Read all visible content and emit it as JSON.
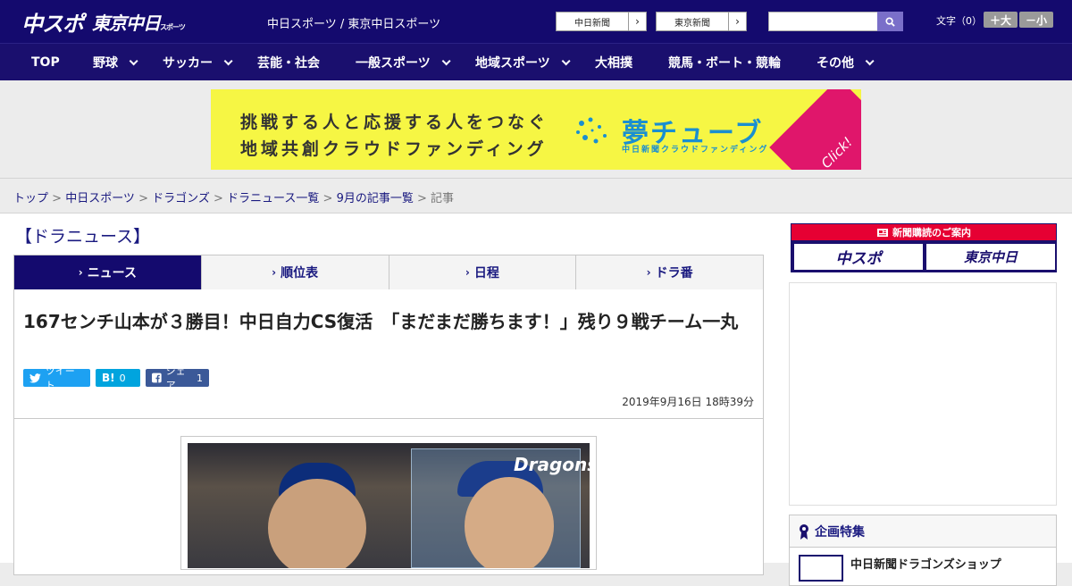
{
  "header": {
    "logo_main": "中スポ",
    "logo_sub": "東京中日",
    "logo_sub_small": "スポーツ",
    "site_title": "中日スポーツ / 東京中日スポーツ",
    "ext_links": [
      {
        "label": "中日新聞"
      },
      {
        "label": "東京新聞"
      }
    ],
    "search_placeholder": "",
    "font_size_label": "文字（0）",
    "font_bigger": "＋大",
    "font_smaller": "－小"
  },
  "nav": {
    "items": [
      {
        "label": "TOP"
      },
      {
        "label": "野球"
      },
      {
        "label": "サッカー"
      },
      {
        "label": "芸能・社会"
      },
      {
        "label": "一般スポーツ"
      },
      {
        "label": "地域スポーツ"
      },
      {
        "label": "大相撲"
      },
      {
        "label": "競馬・ボート・競輪"
      },
      {
        "label": "その他"
      }
    ]
  },
  "banner": {
    "line1": "挑戦する人と応援する人をつなぐ",
    "line2": "地域共創クラウドファンディング",
    "brand": "夢チューブ",
    "brand_sub": "中日新聞クラウドファンディング",
    "click": "Click!"
  },
  "breadcrumb": {
    "items": [
      "トップ",
      "中日スポーツ",
      "ドラゴンズ",
      "ドラニュース一覧",
      "9月の記事一覧"
    ],
    "current": "記事",
    "separator": " > "
  },
  "section_title": "【ドラニュース】",
  "tabs": [
    {
      "label": "ニュース"
    },
    {
      "label": "順位表"
    },
    {
      "label": "日程"
    },
    {
      "label": "ドラ番"
    }
  ],
  "article": {
    "headline": "167センチ山本が３勝目！中日自力CS復活　「まだまだ勝ちます！」残り９戦チーム一丸",
    "date": "2019年9月16日 18時39分",
    "share": {
      "tweet": "ツイート",
      "hatena_label": "B!",
      "hatena_count": "0",
      "facebook": "シェア",
      "facebook_count": "1"
    },
    "photo_text": "Dragons"
  },
  "sidebar": {
    "paper_head": "新聞購読のご案内",
    "paper_links": [
      "中スポ",
      "東京中日"
    ],
    "feature_title": "企画特集",
    "feature_item": "中日新聞ドラゴンズショップ"
  },
  "colors": {
    "header_bg": "#140a6e",
    "nav_bg": "#1a0f6e",
    "banner_bg": "#f6f644",
    "accent_red": "#e60033",
    "twitter": "#1da1f2",
    "hatena": "#00a4de",
    "facebook": "#3b5998"
  }
}
